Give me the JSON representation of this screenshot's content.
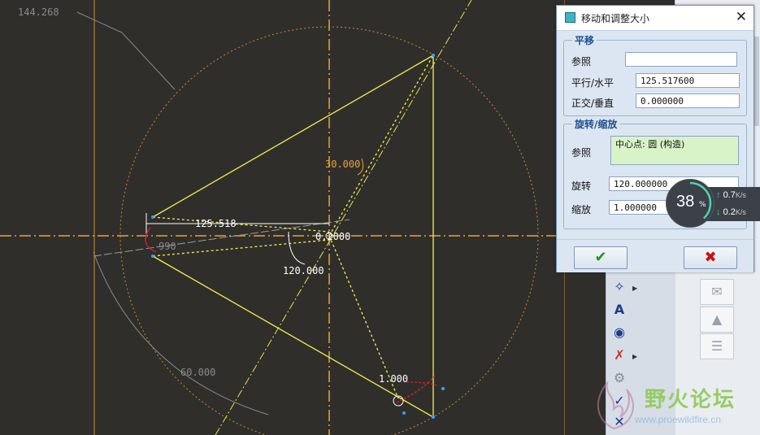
{
  "canvas": {
    "dimensions": {
      "top_left": "144.268",
      "horizontal": "125.518",
      "angle_mid": "120.000",
      "angle_top": "30.000",
      "left_small": "990",
      "center_text": "0.2000",
      "bottom_left": "60.000",
      "scale_label": "1.000"
    }
  },
  "dialog": {
    "title": "移动和调整大小",
    "translate": {
      "legend": "平移",
      "reference_label": "参照",
      "reference_value": "",
      "horizontal_label": "平行/水平",
      "horizontal_value": "125.517600",
      "vertical_label": "正交/垂直",
      "vertical_value": "0.000000"
    },
    "rotate_scale": {
      "legend": "旋转/缩放",
      "reference_label": "参照",
      "reference_value": "中心点: 圆 (构造)",
      "rotate_label": "旋转",
      "rotate_value": "120.000000",
      "scale_label": "缩放",
      "scale_value": "1.000000"
    },
    "ok_icon": "check-icon",
    "cancel_icon": "x-icon"
  },
  "speed_widget": {
    "percent": "38",
    "percent_unit": "%",
    "upload": "0.7",
    "upload_unit": "K/s",
    "download": "0.2",
    "download_unit": "K/s"
  },
  "watermark": {
    "name": "野火论坛",
    "url": "www.proewildfire.cn"
  },
  "colors": {
    "canvas_bg": "#2f2e2b",
    "sketch_yellow": "#f5f04a",
    "axis_orange": "#f0a030",
    "dialog_bg": "#dce6f2",
    "ok_green": "#1a9a1a",
    "cancel_red": "#cc1010"
  }
}
